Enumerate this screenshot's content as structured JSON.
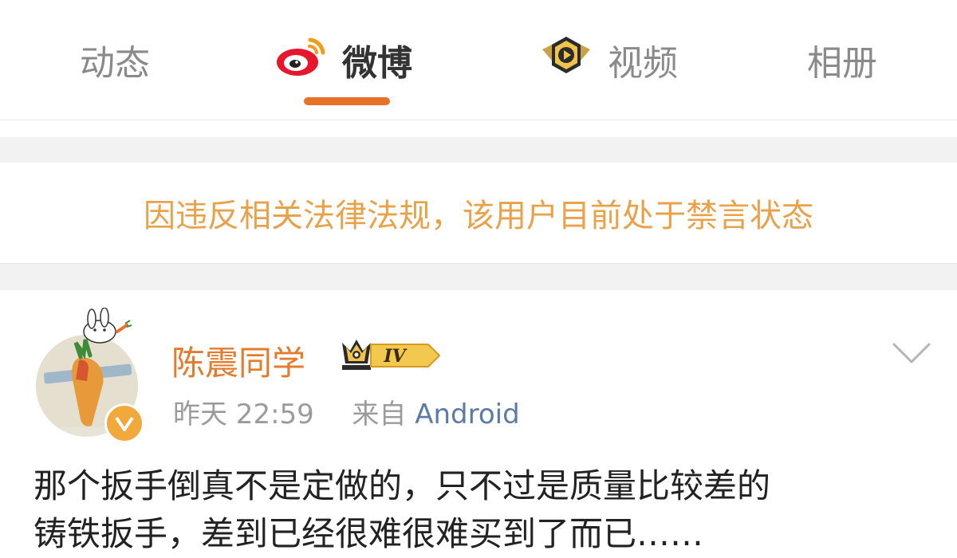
{
  "tabs": [
    {
      "label": "动态",
      "active": false
    },
    {
      "label": "微博",
      "active": true,
      "icon": "weibo-logo-icon"
    },
    {
      "label": "视频",
      "active": false,
      "icon": "video-badge-icon"
    },
    {
      "label": "相册",
      "active": false
    }
  ],
  "notice": "因违反相关法律法规，该用户目前处于禁言状态",
  "post": {
    "username": "陈震同学",
    "level_badge": "IV",
    "date": "昨天 22:59",
    "source_prefix": "来自",
    "source": "Android",
    "body_line1": "那个扳手倒真不是定做的，只不过是质量比较差的",
    "body_line2": "铸铁扳手，差到已经很难很难买到了而已……"
  },
  "colors": {
    "accent": "#e8712a",
    "notice": "#e8a24a",
    "username": "#e37c2f",
    "link": "#5b7aa6"
  }
}
